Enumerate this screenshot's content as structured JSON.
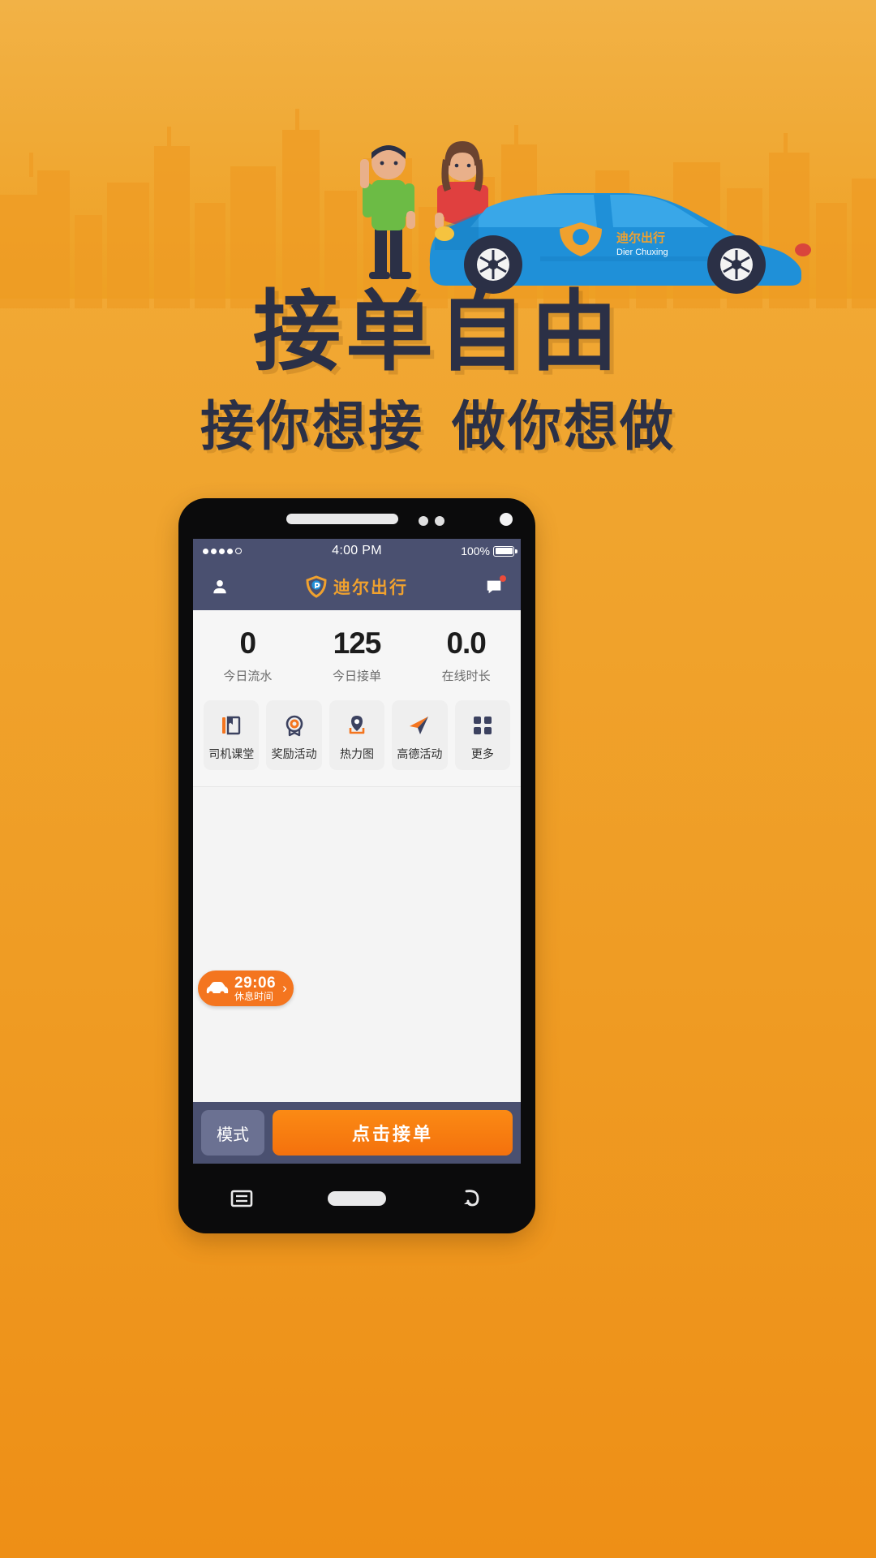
{
  "promo": {
    "title": "接单自由",
    "subtitle_left": "接你想接",
    "subtitle_right": "做你想做"
  },
  "colors": {
    "background_top": "#f2b246",
    "background_bottom": "#ee8f16",
    "headline": "#2b3046",
    "brand_orange": "#f0a12e",
    "accept_orange": "#f4710d",
    "header_navy": "#4a5070",
    "rest_badge": "#f4751f"
  },
  "phone": {
    "status_bar": {
      "signal_dots": 4,
      "time": "4:00 PM",
      "battery_percent": "100%"
    },
    "app_header": {
      "profile_icon": "person-icon",
      "brand_text": "迪尔出行",
      "brand_logo_icon": "shield-logo-icon",
      "message_icon": "message-icon",
      "has_message_badge": true
    },
    "stats": [
      {
        "value": "0",
        "label": "今日流水"
      },
      {
        "value": "125",
        "label": "今日接单"
      },
      {
        "value": "0.0",
        "label": "在线时长"
      }
    ],
    "quick_actions": [
      {
        "icon": "book-icon",
        "label": "司机课堂"
      },
      {
        "icon": "medal-icon",
        "label": "奖励活动"
      },
      {
        "icon": "map-pin-icon",
        "label": "热力图"
      },
      {
        "icon": "paper-plane-icon",
        "label": "高德活动"
      },
      {
        "icon": "grid-icon",
        "label": "更多"
      }
    ],
    "rest_badge": {
      "icon": "car-icon",
      "time": "29:06",
      "label": "休息时间",
      "chevron": "›"
    },
    "action_bar": {
      "mode_label": "模式",
      "accept_label": "点击接单"
    },
    "nav_bar": {
      "recents_icon": "recents-icon",
      "home_icon": "home-pill-icon",
      "back_icon": "back-icon"
    }
  },
  "hero": {
    "car_brand_text": "迪尔出行",
    "car_brand_sub": "Dier Chuxing"
  }
}
